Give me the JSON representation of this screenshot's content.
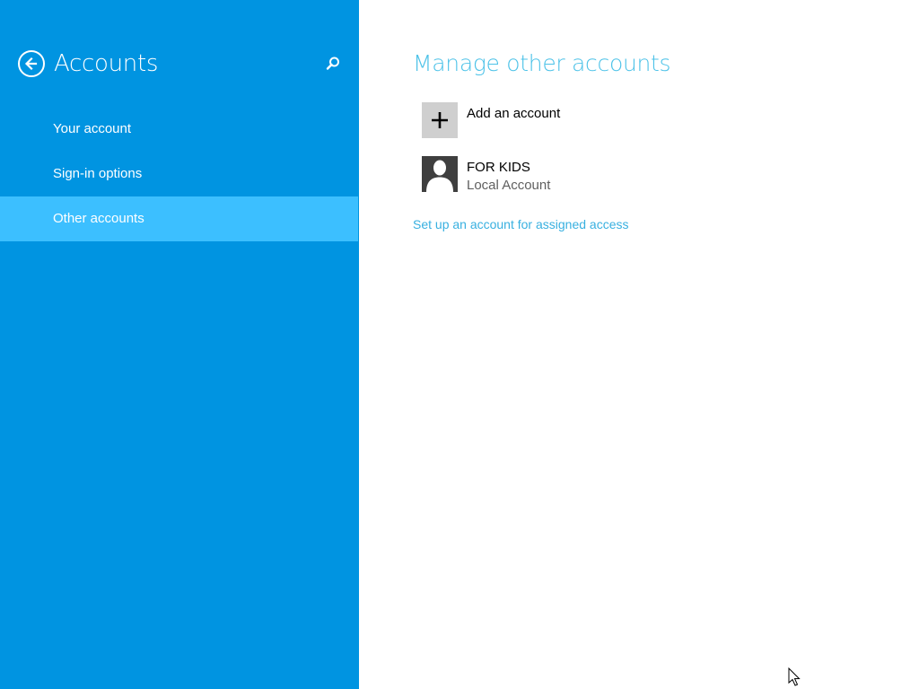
{
  "sidebar": {
    "title": "Accounts",
    "back_icon": "back-arrow-icon",
    "search_icon": "search-icon",
    "background": "#0094e1",
    "selected_background": "#3cbfff",
    "items": [
      {
        "label": "Your account",
        "selected": false
      },
      {
        "label": "Sign-in options",
        "selected": false
      },
      {
        "label": "Other accounts",
        "selected": true
      }
    ]
  },
  "main": {
    "title": "Manage other accounts",
    "accent_color": "#4cc2e8",
    "add_account": {
      "label": "Add an account",
      "icon": "plus-icon"
    },
    "accounts": [
      {
        "name": "FOR KIDS",
        "type": "Local Account",
        "icon": "user-avatar-icon"
      }
    ],
    "assigned_access_link": "Set up an account for assigned access"
  }
}
